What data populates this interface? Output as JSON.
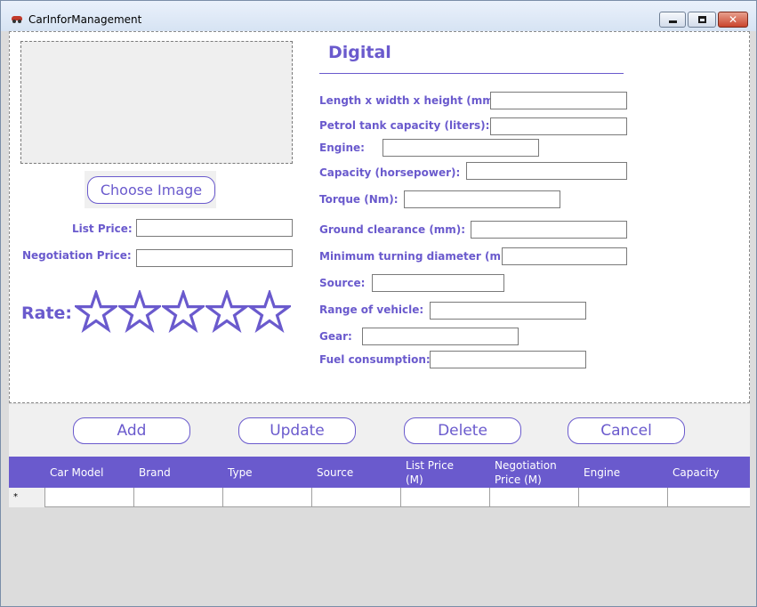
{
  "window": {
    "title": "CarInforManagement"
  },
  "left": {
    "choose_image_label": "Choose Image",
    "list_price_label": "List Price:",
    "negotiation_price_label": "Negotiation Price:",
    "list_price_value": "",
    "negotiation_price_value": "",
    "rate_label": "Rate:",
    "rating": {
      "value": 0,
      "max": 5
    }
  },
  "digital": {
    "title": "Digital",
    "fields": [
      {
        "label": "Length x width x height (mm):",
        "value": ""
      },
      {
        "label": "Petrol tank capacity (liters):",
        "value": ""
      },
      {
        "label": "Engine:",
        "value": ""
      },
      {
        "label": "Capacity (horsepower):",
        "value": ""
      },
      {
        "label": "Torque (Nm):",
        "value": ""
      },
      {
        "label": "Ground clearance (mm):",
        "value": ""
      },
      {
        "label": "Minimum turning diameter (m):",
        "value": ""
      },
      {
        "label": "Source:",
        "value": ""
      },
      {
        "label": "Range of vehicle:",
        "value": ""
      },
      {
        "label": "Gear:",
        "value": ""
      },
      {
        "label": "Fuel consumption:",
        "value": ""
      }
    ]
  },
  "actions": {
    "add": "Add",
    "update": "Update",
    "delete": "Delete",
    "cancel": "Cancel"
  },
  "grid": {
    "columns": [
      "Car Model",
      "Brand",
      "Type",
      "Source",
      "List Price (M)",
      "Negotiation Price (M)",
      "Engine",
      "Capacity"
    ],
    "new_row_marker": "*"
  },
  "colors": {
    "accent": "#6a5acd",
    "grid_header": "#6a5acd",
    "background": "#dcdcdc"
  },
  "icons": {
    "app": "car-icon",
    "minimize": "minimize-icon",
    "maximize": "maximize-icon",
    "close": "close-icon",
    "star": "star-outline-icon"
  }
}
